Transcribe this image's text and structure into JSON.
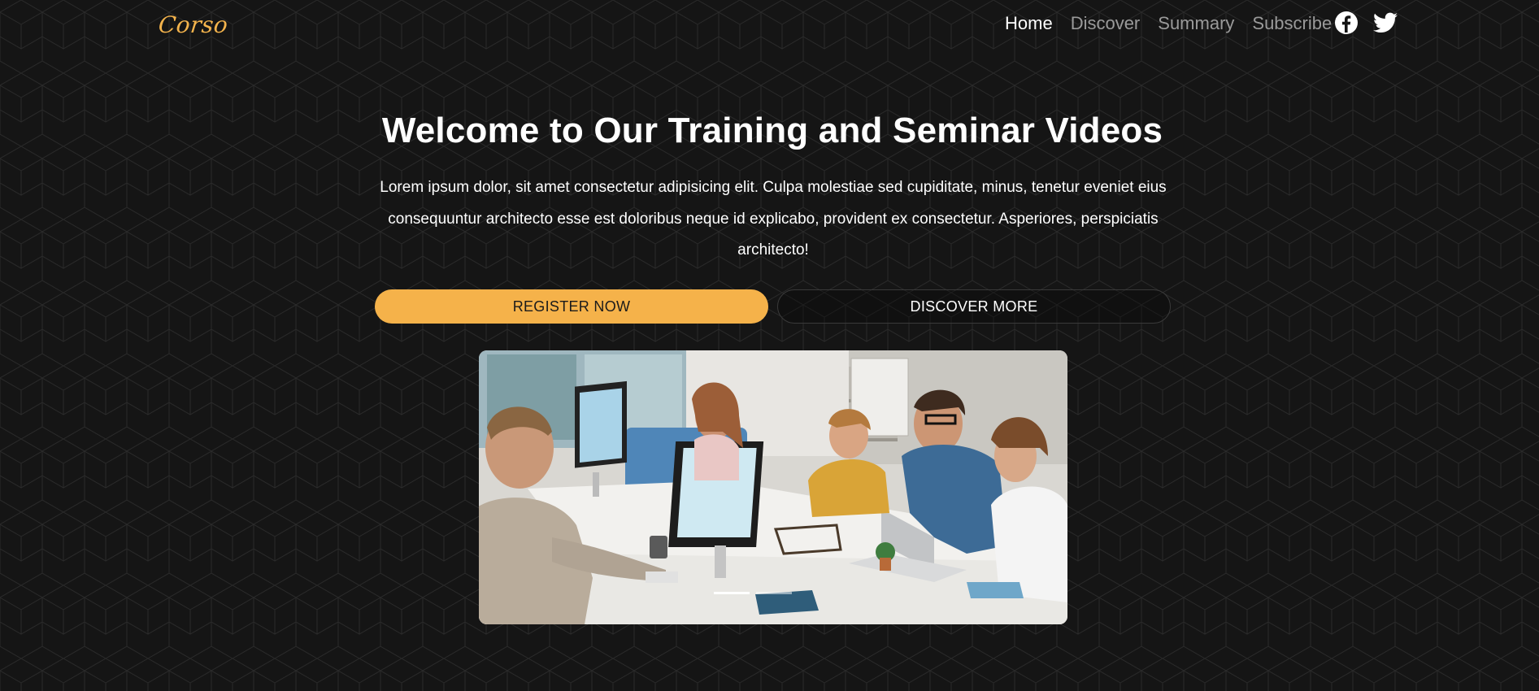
{
  "nav": {
    "logo": "Corso",
    "links": [
      {
        "label": "Home",
        "active": true
      },
      {
        "label": "Discover",
        "active": false
      },
      {
        "label": "Summary",
        "active": false
      },
      {
        "label": "Subscribe",
        "active": false
      }
    ],
    "social": [
      "facebook-icon",
      "twitter-icon"
    ]
  },
  "hero": {
    "title": "Welcome to Our Training and Seminar Videos",
    "description": "Lorem ipsum dolor, sit amet consectetur adipisicing elit. Culpa molestiae sed cupiditate, minus, tenetur eveniet eius consequuntur architecto esse est doloribus neque id explicabo, provident ex consectetur. Asperiores, perspiciatis architecto!",
    "register_label": "REGISTER NOW",
    "discover_label": "DISCOVER MORE"
  },
  "carousel": {
    "slide_count": 2,
    "active_slide": 1
  },
  "colors": {
    "accent": "#f5b24a",
    "background": "#141414",
    "nav_inactive": "#9a9a9a"
  }
}
